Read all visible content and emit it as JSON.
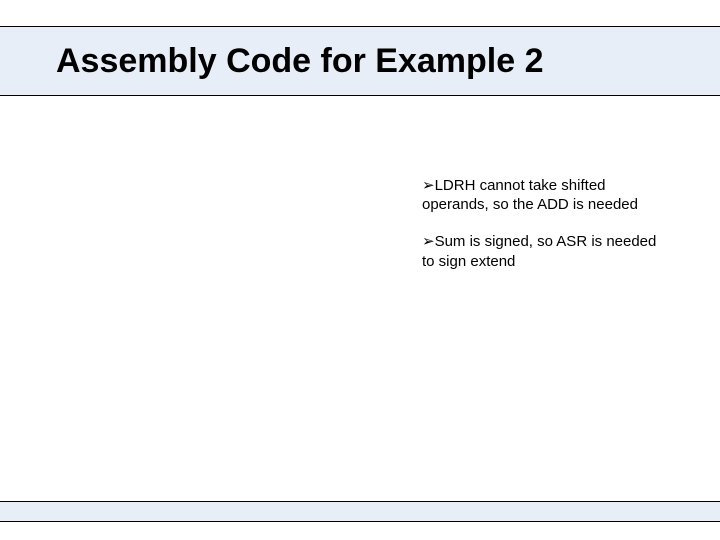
{
  "title": "Assembly Code for Example 2",
  "notes": [
    {
      "bullet": "➢",
      "text": "LDRH cannot take shifted operands, so the ADD is needed"
    },
    {
      "bullet": "➢",
      "text": "Sum is signed, so ASR is needed to sign extend"
    }
  ]
}
